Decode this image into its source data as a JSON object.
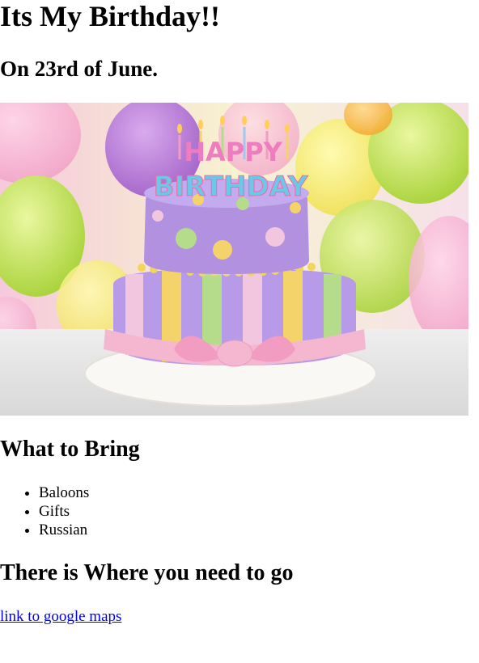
{
  "page": {
    "title": "Its My Birthday!!",
    "date_heading": "On 23rd of June.",
    "image": {
      "icon": "birthday-cake-image",
      "cake_topper_line1": "HAPPY",
      "cake_topper_line2": "BIRTHDAY"
    },
    "bring_heading": "What to Bring",
    "bring_items": [
      "Baloons",
      "Gifts",
      "Russian"
    ],
    "where_heading": "There is Where you need to go",
    "maps_link": "link to google maps"
  },
  "colors": {
    "link": "#0000ee",
    "text": "#000000",
    "background": "#ffffff"
  }
}
